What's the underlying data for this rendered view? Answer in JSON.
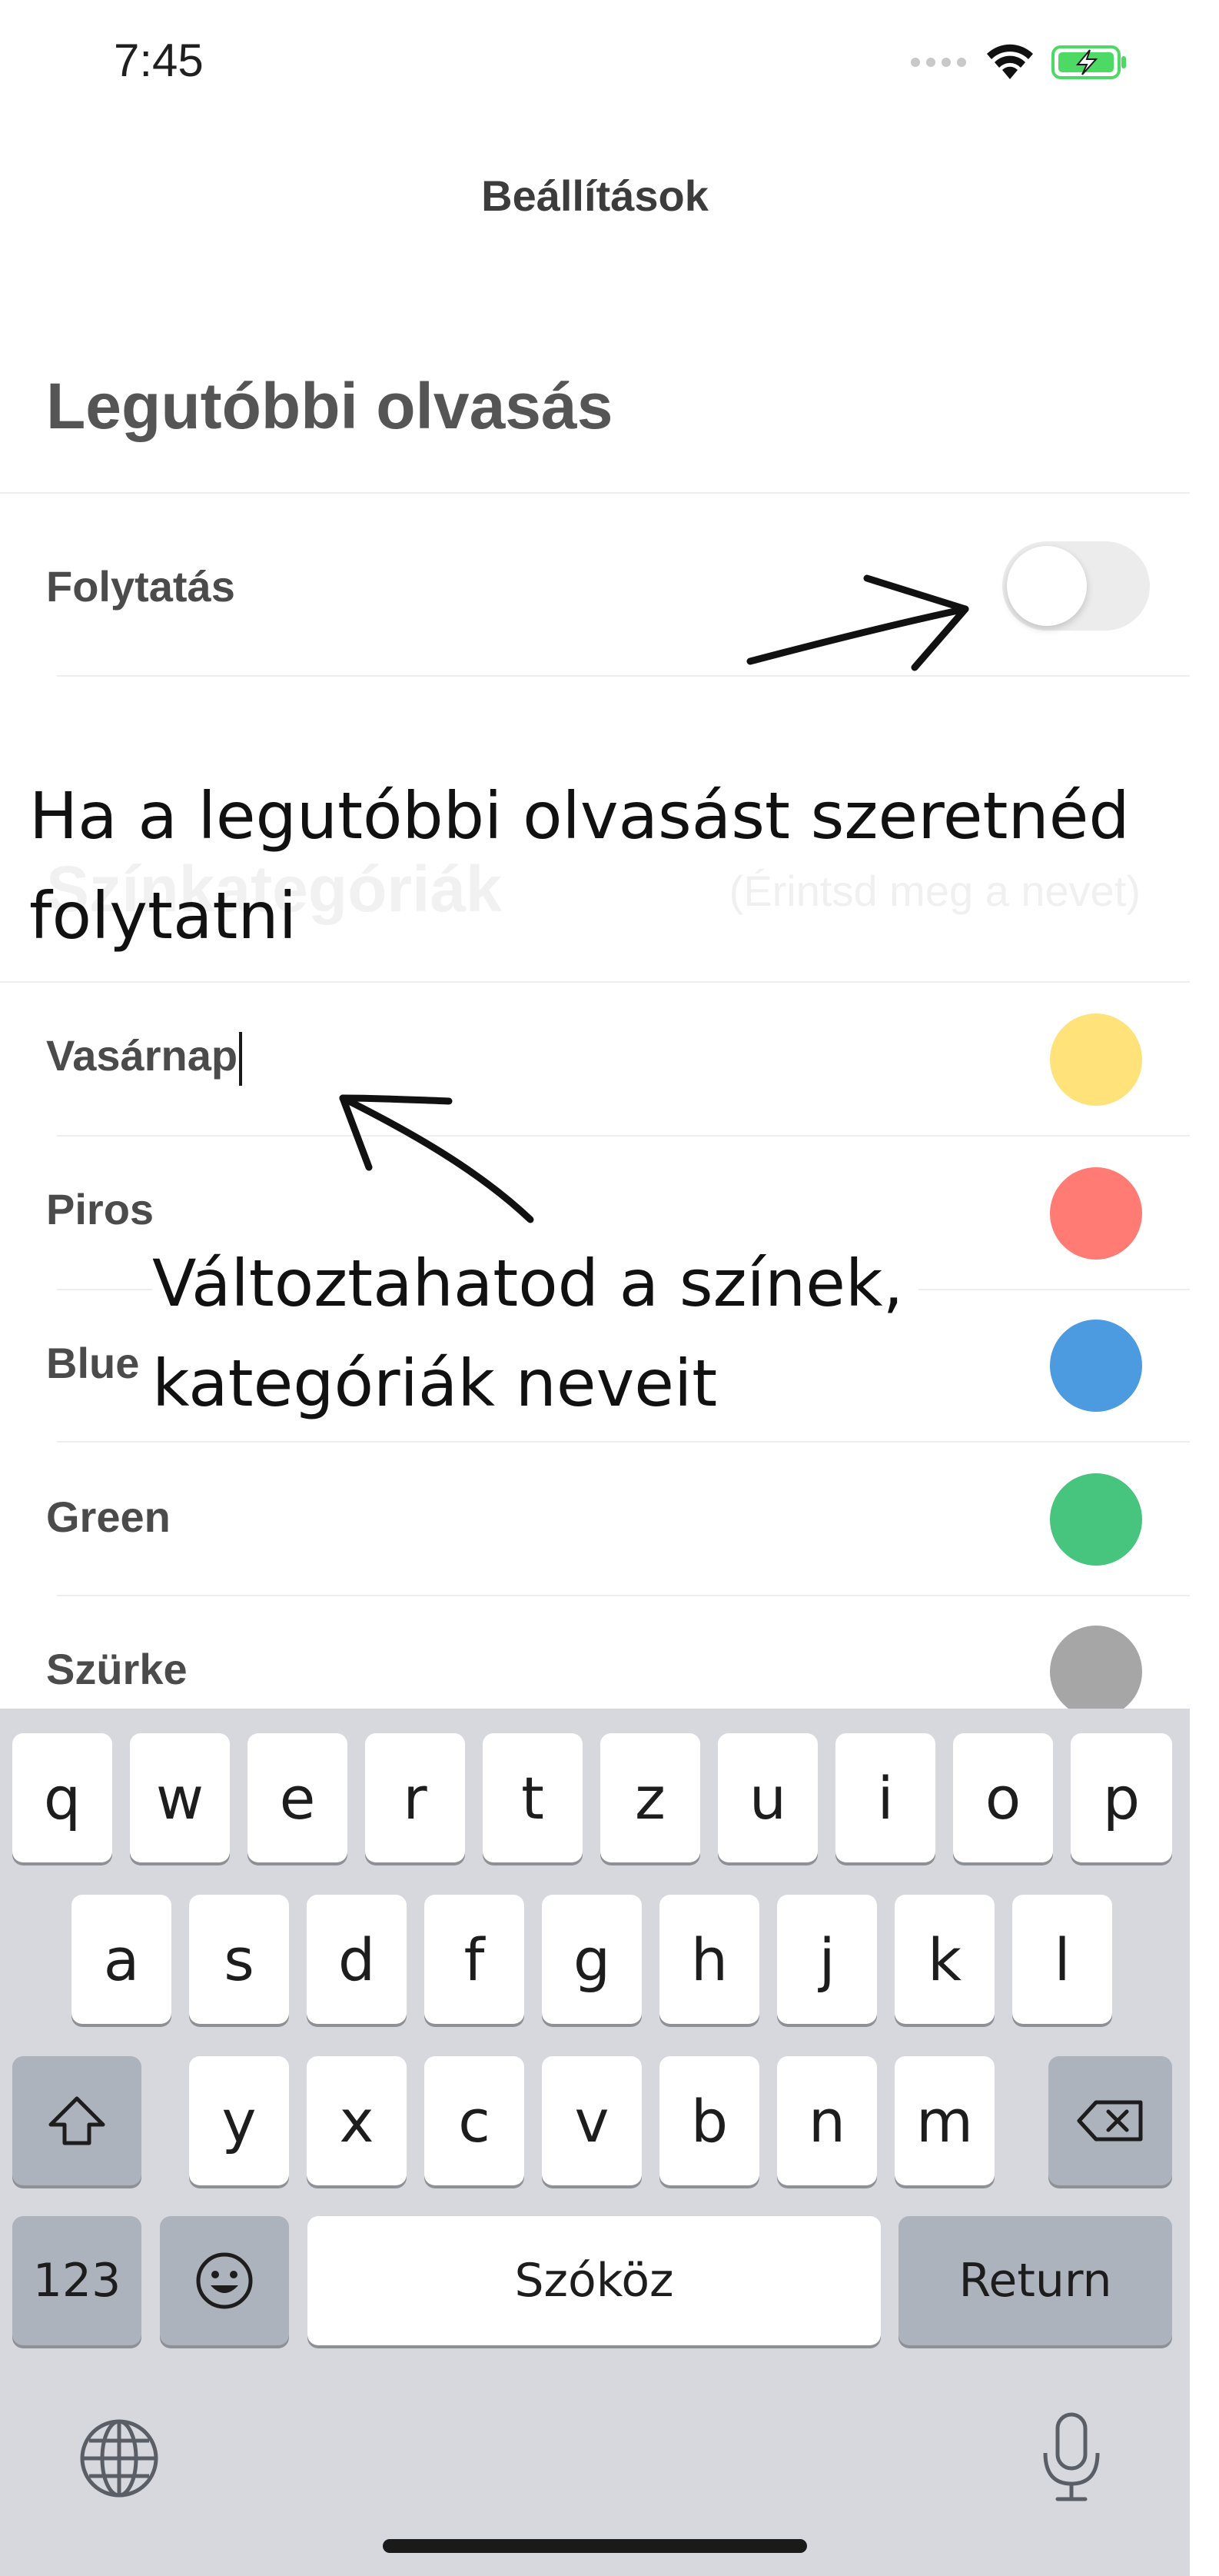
{
  "status_bar": {
    "time": "7:45",
    "signal_icon": "signal-dots-icon",
    "wifi_icon": "wifi-icon",
    "battery_icon": "battery-charging-icon",
    "battery_color": "#4cd964"
  },
  "nav": {
    "title": "Beállítások"
  },
  "recent_reading": {
    "title": "Legutóbbi olvasás",
    "continue_label": "Folytatás",
    "continue_on": false
  },
  "annotation_toggle": {
    "line1": "Ha a legutóbbi olvasást szeretnéd",
    "line2": "folytatni"
  },
  "color_categories": {
    "title": "Színkategóriák",
    "hint": "(Érintsd meg a nevet)",
    "items": [
      {
        "label": "Vasárnap",
        "color": "#ffe27a"
      },
      {
        "label": "Piros",
        "color": "#ff7b73"
      },
      {
        "label": "Blue",
        "color": "#4c9be1"
      },
      {
        "label": "Green",
        "color": "#47c47e"
      },
      {
        "label": "Szürke",
        "color": "#a6a6a6"
      }
    ]
  },
  "annotation_categories": {
    "line1": "Változtahatod a színek,",
    "line2": "kategóriák neveit"
  },
  "keyboard": {
    "row1": [
      "q",
      "w",
      "e",
      "r",
      "t",
      "z",
      "u",
      "i",
      "o",
      "p"
    ],
    "row2": [
      "a",
      "s",
      "d",
      "f",
      "g",
      "h",
      "j",
      "k",
      "l"
    ],
    "row3": [
      "y",
      "x",
      "c",
      "v",
      "b",
      "n",
      "m"
    ],
    "shift_icon": "shift-icon",
    "backspace_icon": "backspace-icon",
    "numbers_label": "123",
    "emoji_icon": "emoji-icon",
    "space_label": "Szóköz",
    "return_label": "Return",
    "globe_icon": "globe-icon",
    "mic_icon": "microphone-icon"
  }
}
